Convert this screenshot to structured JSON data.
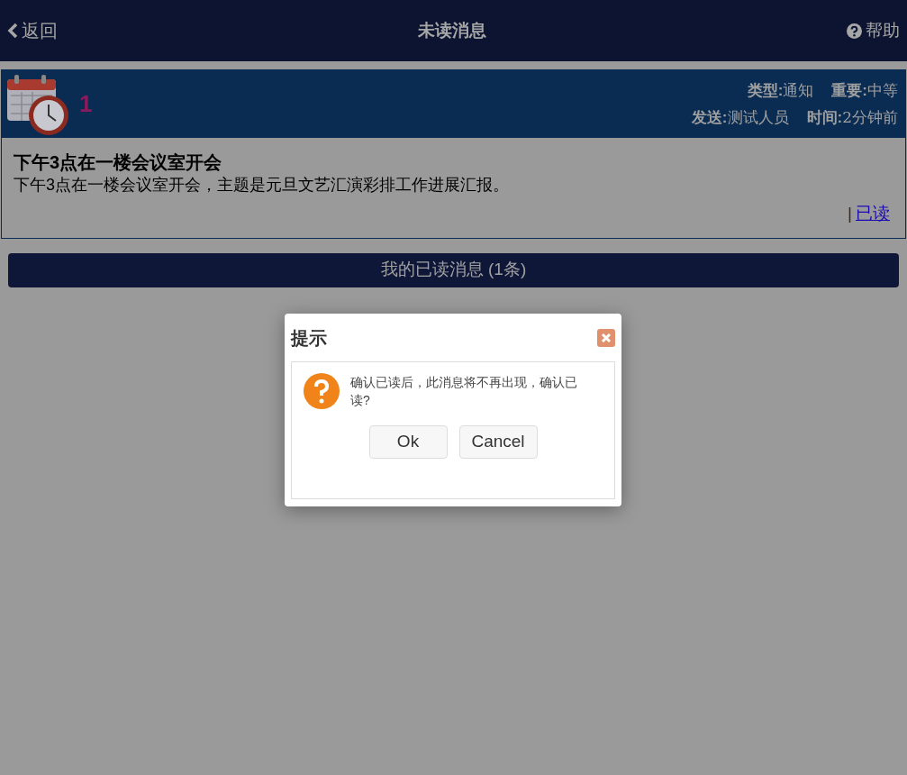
{
  "top_bar": {
    "back": "返回",
    "title": "未读消息",
    "help": "帮助"
  },
  "message": {
    "count": "1",
    "meta": [
      {
        "label": "类型:",
        "value": "通知"
      },
      {
        "label": "重要:",
        "value": "中等"
      },
      {
        "label": "发送:",
        "value": "测试人员"
      },
      {
        "label": "时间:",
        "value": "2分钟前"
      }
    ],
    "title": "下午3点在一楼会议室开会",
    "body": "下午3点在一楼会议室开会，主题是元旦文艺汇演彩排工作进展汇报。",
    "separator": "|",
    "action": "已读"
  },
  "read_messages_button": "我的已读消息 (1条)",
  "dialog": {
    "title": "提示",
    "text": "确认已读后，此消息将不再出现，确认已读?",
    "buttons": [
      "Ok",
      "Cancel"
    ]
  }
}
